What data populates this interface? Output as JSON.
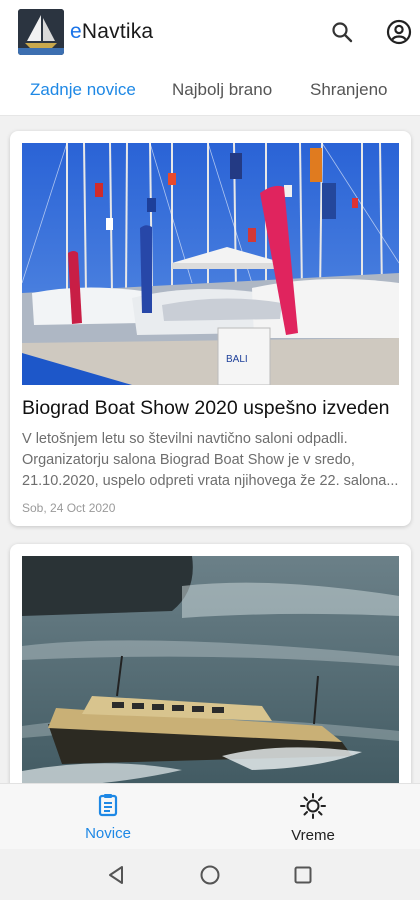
{
  "app": {
    "title_prefix": "e",
    "title_rest": "Navtika"
  },
  "tabs": [
    {
      "label": "Zadnje novice",
      "active": true
    },
    {
      "label": "Najbolj brano",
      "active": false
    },
    {
      "label": "Shranjeno",
      "active": false
    }
  ],
  "articles": [
    {
      "title": "Biograd Boat Show 2020 uspešno izveden",
      "excerpt_lines": [
        "V letošnjem letu so številni navtično saloni odpadli.",
        "Organizatorju salona Biograd Boat Show je v sredo,",
        "21.10.2020, uspelo odpreti vrata njihovega že 22. salona..."
      ],
      "date": "Sob, 24 Oct 2020",
      "sign_text": "BALI"
    },
    {
      "title": "",
      "date": ""
    }
  ],
  "bottom_nav": [
    {
      "label": "Novice",
      "active": true
    },
    {
      "label": "Vreme",
      "active": false
    }
  ],
  "colors": {
    "accent": "#1e88e5",
    "sky": "#2f6ed8",
    "sea": "#4c6670"
  },
  "icons": [
    "search-icon",
    "account-icon",
    "news-icon",
    "weather-sun-icon",
    "back-icon",
    "home-icon",
    "recents-icon"
  ]
}
